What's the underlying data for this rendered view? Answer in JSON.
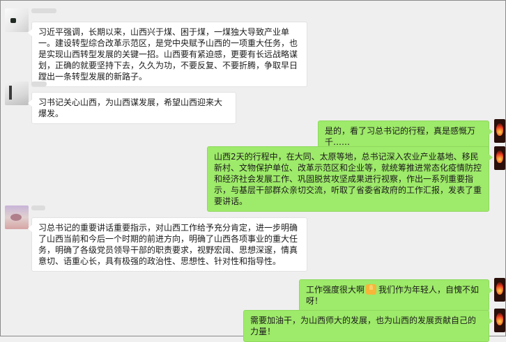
{
  "messages": [
    {
      "side": "left",
      "text": "习近平强调，长期以来，山西兴于煤、困于煤，一煤独大导致产业单一。建设转型综合改革示范区，是党中央赋予山西的一项重大任务，也是实现山西转型发展的关键一招。山西要有紧迫感，更要有长远战略谋划，正确的就要坚持下去，久久为功，不要反复、不要折腾，争取早日蹚出一条转型发展的新路子。"
    },
    {
      "side": "left",
      "text": "习书记关心山西，为山西谋发展，希望山西迎来大爆发。"
    },
    {
      "side": "right",
      "text": "是的，看了习总书记的行程，真是感慨万千……"
    },
    {
      "side": "right",
      "text": "山西2天的行程中，在大同、太原等地，总书记深入农业产业基地、移民新村、文物保护单位、改革示范区和企业等，就统筹推进常态化疫情防控和经济社会发展工作、巩固脱贫攻坚成果进行视察，作出一系列重要指示，与基层干部群众亲切交流，听取了省委省政府的工作汇报，发表了重要讲话。"
    },
    {
      "side": "left",
      "text": "习总书记的重要讲话重要指示，对山西工作给予充分肯定，进一步明确了山西当前和今后一个时期的前进方向，明确了山西各项事业的重大任务，明确了各级党员领导干部的职责要求，视野宏阔、思想深邃，情真意切、语重心长，具有极强的政治性、思想性、针对性和指导性。"
    },
    {
      "side": "right",
      "text_before": "工作强度很大啊",
      "emoji": "thumbs-up-emoji",
      "text_after": "我们作为年轻人，自愧不如呀！"
    },
    {
      "side": "right",
      "text": "需要加油干，为山西师大的发展，也为山西的发展贡献自己的力量！"
    }
  ],
  "colors": {
    "background": "#efefef",
    "incoming_bubble": "#ffffff",
    "outgoing_bubble": "#9eea6a"
  }
}
